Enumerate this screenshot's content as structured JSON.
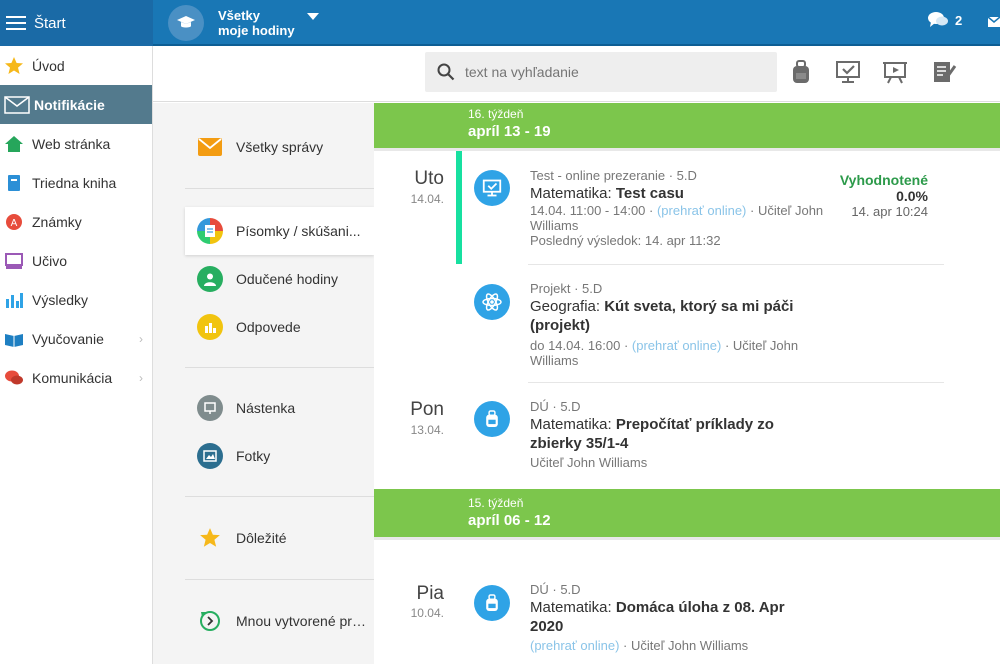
{
  "topbar": {
    "start_label": "Štart",
    "class_line1": "Všetky",
    "class_line2": "moje hodiny",
    "chat_count": "2"
  },
  "sidebar": {
    "items": [
      {
        "label": "Úvod",
        "icon": "star-icon"
      },
      {
        "label": "Notifikácie",
        "icon": "envelope-icon"
      },
      {
        "label": "Web stránka",
        "icon": "home-icon"
      },
      {
        "label": "Triedna kniha",
        "icon": "book-icon"
      },
      {
        "label": "Známky",
        "icon": "grades-icon"
      },
      {
        "label": "Učivo",
        "icon": "screen-icon"
      },
      {
        "label": "Výsledky",
        "icon": "bar-chart-icon"
      },
      {
        "label": "Vyučovanie",
        "icon": "open-book-icon"
      },
      {
        "label": "Komunikácia",
        "icon": "chat-icon"
      }
    ]
  },
  "search": {
    "placeholder": "text na vyhľadanie"
  },
  "filters": {
    "all_messages": "Všetky správy",
    "tests": "Písomky / skúšani...",
    "lessons": "Odučené hodiny",
    "answers": "Odpovede",
    "board": "Nástenka",
    "photos": "Fotky",
    "important": "Dôležité",
    "created_by_me": "Mnou vytvorené prí..."
  },
  "feed": {
    "week1": {
      "num": "16. týždeň",
      "range": "apríl 13 - 19"
    },
    "week2": {
      "num": "15. týždeň",
      "range": "apríl 06 - 12"
    },
    "days": [
      {
        "name": "Uto",
        "date": "14.04."
      },
      {
        "name": "Pon",
        "date": "13.04."
      },
      {
        "name": "Pia",
        "date": "10.04."
      }
    ],
    "events": [
      {
        "sub": "Test - online prezeranie · 5.D",
        "subject": "Matematika:",
        "title": "Test casu",
        "meta1": "14.04. 11:00 - 14:00 · ",
        "link": "(prehrať online)",
        "meta1b": " · Učiteľ John",
        "meta2": "Williams",
        "meta3": "Posledný výsledok: 14. apr 11:32",
        "status1": "Vyhodnotené",
        "status2": "0.0%",
        "status3": "14. apr 10:24"
      },
      {
        "sub": "Projekt · 5.D",
        "subject": "Geografia:",
        "title": "Kút sveta, ktorý sa mi páči",
        "title2": "(projekt)",
        "meta1": "do 14.04. 16:00 · ",
        "link": "(prehrať online)",
        "meta1b": " · Učiteľ John",
        "meta2": "Williams"
      },
      {
        "sub": "DÚ · 5.D",
        "subject": "Matematika:",
        "title": "Prepočítať príklady zo",
        "title2": "zbierky 35/1-4",
        "meta1": "Učiteľ John Williams"
      },
      {
        "sub": "DÚ · 5.D",
        "subject": "Matematika:",
        "title": "Domáca úloha z 08. Apr",
        "title2": "2020",
        "link": "(prehrať online)",
        "meta1b": " · Učiteľ John Williams"
      }
    ]
  },
  "colors": {
    "topbar": "#1977b5",
    "week": "#7cc64c",
    "active_side": "#537a8d",
    "accent_green": "#2c9a4a"
  }
}
